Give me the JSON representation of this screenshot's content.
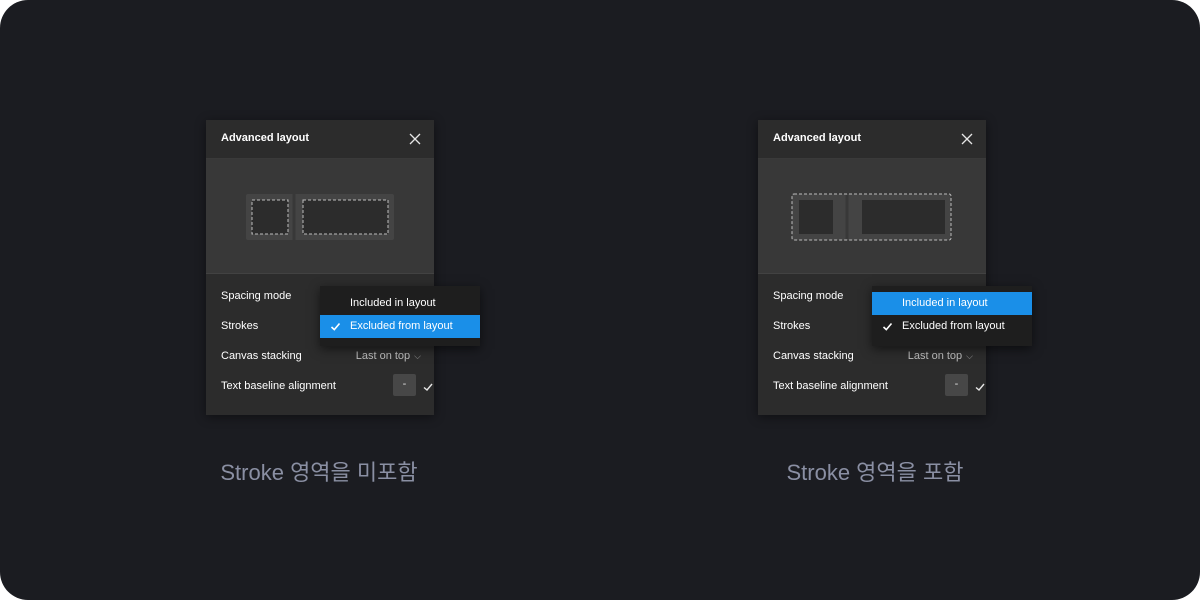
{
  "colors": {
    "background": "#1b1c21",
    "panel": "#2c2c2c",
    "dropdown": "#1e1e1e",
    "selected": "#1a8fe8",
    "caption": "#8a8fa3"
  },
  "panels": [
    {
      "title": "Advanced layout",
      "close_icon": "close-icon",
      "rows": {
        "spacing_mode": "Spacing mode",
        "strokes": "Strokes",
        "canvas_stacking": "Canvas stacking",
        "canvas_stacking_value": "Last on top",
        "text_baseline": "Text baseline alignment",
        "text_baseline_value": "-"
      },
      "dropdown": {
        "options": [
          "Included in layout",
          "Excluded from layout"
        ],
        "selected": "Excluded from layout",
        "highlighted": "Excluded from layout"
      },
      "caption": "Stroke 영역을 미포함"
    },
    {
      "title": "Advanced layout",
      "close_icon": "close-icon",
      "rows": {
        "spacing_mode": "Spacing mode",
        "strokes": "Strokes",
        "canvas_stacking": "Canvas stacking",
        "canvas_stacking_value": "Last on top",
        "text_baseline": "Text baseline alignment",
        "text_baseline_value": "-"
      },
      "dropdown": {
        "options": [
          "Included in layout",
          "Excluded from layout"
        ],
        "selected": "Excluded from layout",
        "highlighted": "Included in layout"
      },
      "caption": "Stroke 영역을 포함"
    }
  ]
}
